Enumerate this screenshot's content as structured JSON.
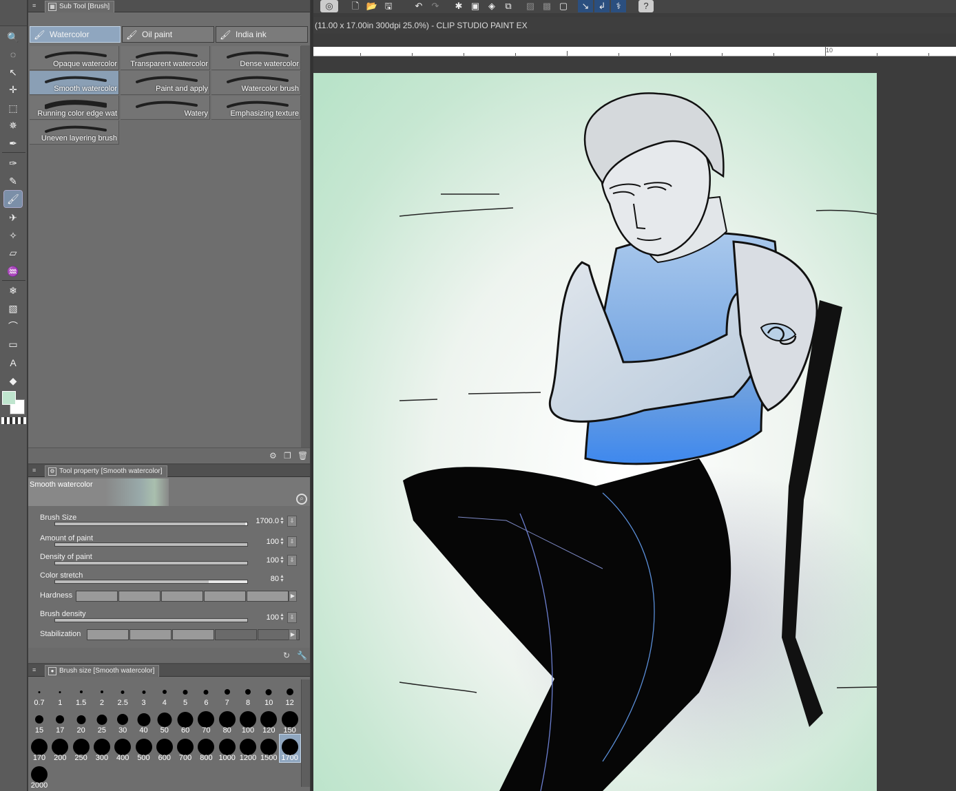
{
  "document": {
    "info": "(11.00 x 17.00in 300dpi 25.0%)  - CLIP STUDIO PAINT EX",
    "ruler_label": "10"
  },
  "toolbar": {
    "tools": [
      "zoom-icon",
      "lasso-icon",
      "operation-icon",
      "move-icon",
      "selection-icon",
      "auto-select-icon",
      "eyedropper-icon",
      "pen-icon",
      "pencil-icon",
      "brush-icon",
      "airbrush-icon",
      "decoration-icon",
      "eraser-icon",
      "blend-icon",
      "fill-icon",
      "gradient-icon",
      "figure-icon",
      "frame-icon",
      "text-icon",
      "balloon-icon"
    ],
    "colors": {
      "main": "#bfe5ce",
      "sub": "#ffffff"
    }
  },
  "subtool": {
    "title": "Sub Tool [Brush]",
    "groups": [
      "Watercolor",
      "Oil paint",
      "India ink"
    ],
    "active_group": "Watercolor",
    "brushes": [
      "Opaque watercolor",
      "Transparent watercolor",
      "Dense watercolor",
      "Smooth watercolor",
      "Paint and apply",
      "Watercolor brush",
      "Running color edge wat",
      "Watery",
      "Emphasizing texture",
      "Uneven layering brush"
    ],
    "active_brush": "Smooth watercolor"
  },
  "tool_property": {
    "title": "Tool property [Smooth watercolor]",
    "preset_name": "Smooth watercolor",
    "params": [
      {
        "label": "Brush Size",
        "value": "1700.0",
        "fill": 0.99
      },
      {
        "label": "Amount of paint",
        "value": "100",
        "fill": 1.0
      },
      {
        "label": "Density of paint",
        "value": "100",
        "fill": 1.0
      },
      {
        "label": "Color stretch",
        "value": "80",
        "fill": 0.8
      },
      {
        "label": "Hardness"
      },
      {
        "label": "Brush density",
        "value": "100",
        "fill": 1.0
      },
      {
        "label": "Stabilization"
      }
    ],
    "hardness_level": 5,
    "stabilization_level": 3
  },
  "brush_size": {
    "title": "Brush size [Smooth watercolor]",
    "sizes": [
      "0.7",
      "1",
      "1.5",
      "2",
      "2.5",
      "3",
      "4",
      "5",
      "6",
      "7",
      "8",
      "10",
      "12",
      "15",
      "17",
      "20",
      "25",
      "30",
      "40",
      "50",
      "60",
      "70",
      "80",
      "100",
      "120",
      "150",
      "170",
      "200",
      "250",
      "300",
      "400",
      "500",
      "600",
      "700",
      "800",
      "1000",
      "1200",
      "1500",
      "1700",
      "2000"
    ],
    "active_size": "1700"
  }
}
